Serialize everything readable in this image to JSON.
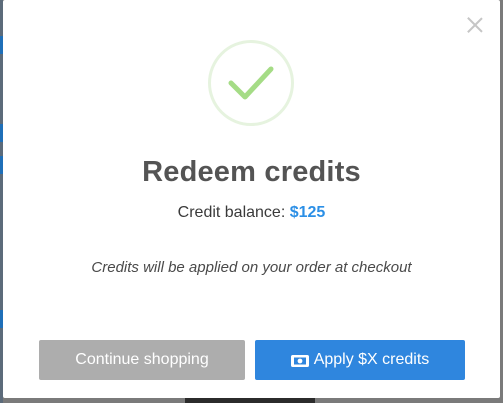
{
  "modal": {
    "title": "Redeem credits",
    "balance_label": "Credit balance:",
    "balance_amount": "$125",
    "note": "Credits will be applied on your order at checkout",
    "secondary_button": "Continue shopping",
    "primary_button": "Apply $X credits",
    "icons": {
      "close": "close-icon",
      "success": "checkmark-icon",
      "primary_button_icon": "money-icon"
    }
  },
  "colors": {
    "accent": "#2f86de",
    "amount": "#2b8fe6",
    "secondary_button": "#adadad",
    "check": "#a5dc86",
    "title": "#545454"
  }
}
